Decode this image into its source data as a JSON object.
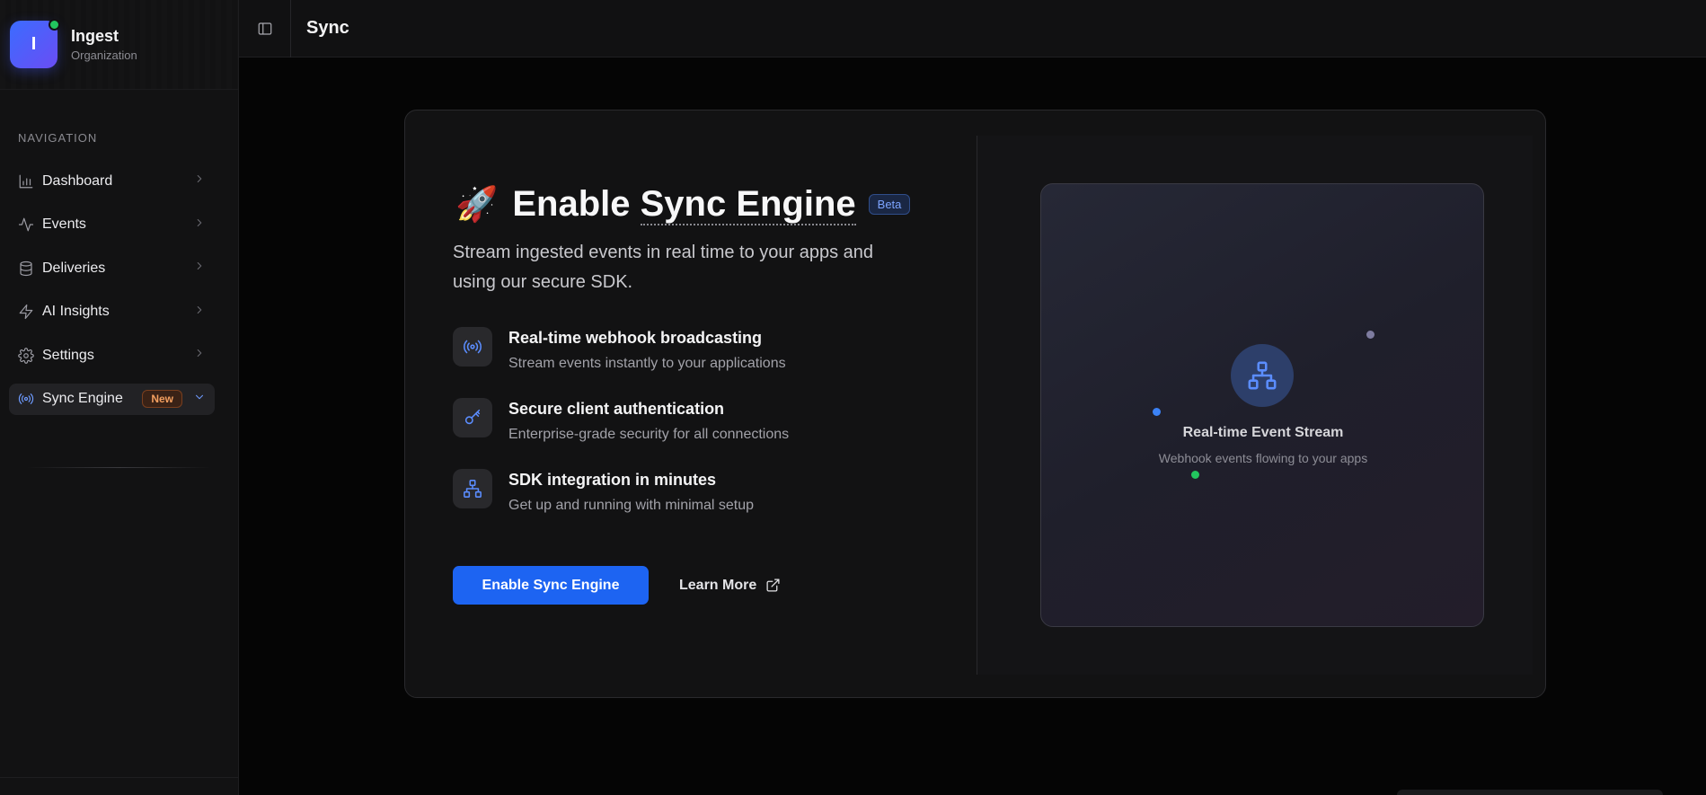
{
  "org": {
    "initial": "I",
    "name": "Ingest",
    "type": "Organization"
  },
  "nav": {
    "heading": "NAVIGATION",
    "items": [
      {
        "label": "Dashboard",
        "icon": "bar-chart-icon"
      },
      {
        "label": "Events",
        "icon": "activity-icon"
      },
      {
        "label": "Deliveries",
        "icon": "database-icon"
      },
      {
        "label": "AI Insights",
        "icon": "zap-icon"
      },
      {
        "label": "Settings",
        "icon": "gear-icon"
      },
      {
        "label": "Sync Engine",
        "icon": "broadcast-icon",
        "badge": "New",
        "active": true
      }
    ]
  },
  "header": {
    "title": "Sync"
  },
  "hero": {
    "emoji": "🚀",
    "title_pre": "Enable ",
    "title_dotted": "Sync Engine",
    "badge": "Beta",
    "subtitle": "Stream ingested events in real time to your apps and using our secure SDK."
  },
  "features": [
    {
      "title": "Real-time webhook broadcasting",
      "desc": "Stream events instantly to your applications",
      "icon": "broadcast-icon"
    },
    {
      "title": "Secure client authentication",
      "desc": "Enterprise-grade security for all connections",
      "icon": "key-icon"
    },
    {
      "title": "SDK integration in minutes",
      "desc": "Get up and running with minimal setup",
      "icon": "network-icon"
    }
  ],
  "actions": {
    "primary": "Enable Sync Engine",
    "secondary": "Learn More"
  },
  "preview": {
    "title": "Real-time Event Stream",
    "desc": "Webhook events flowing to your apps",
    "icon": "network-icon"
  },
  "colors": {
    "accent": "#1d64f2",
    "status_online": "#22c55e",
    "badge_new": "#f5a060",
    "badge_beta": "#7da4ff"
  }
}
